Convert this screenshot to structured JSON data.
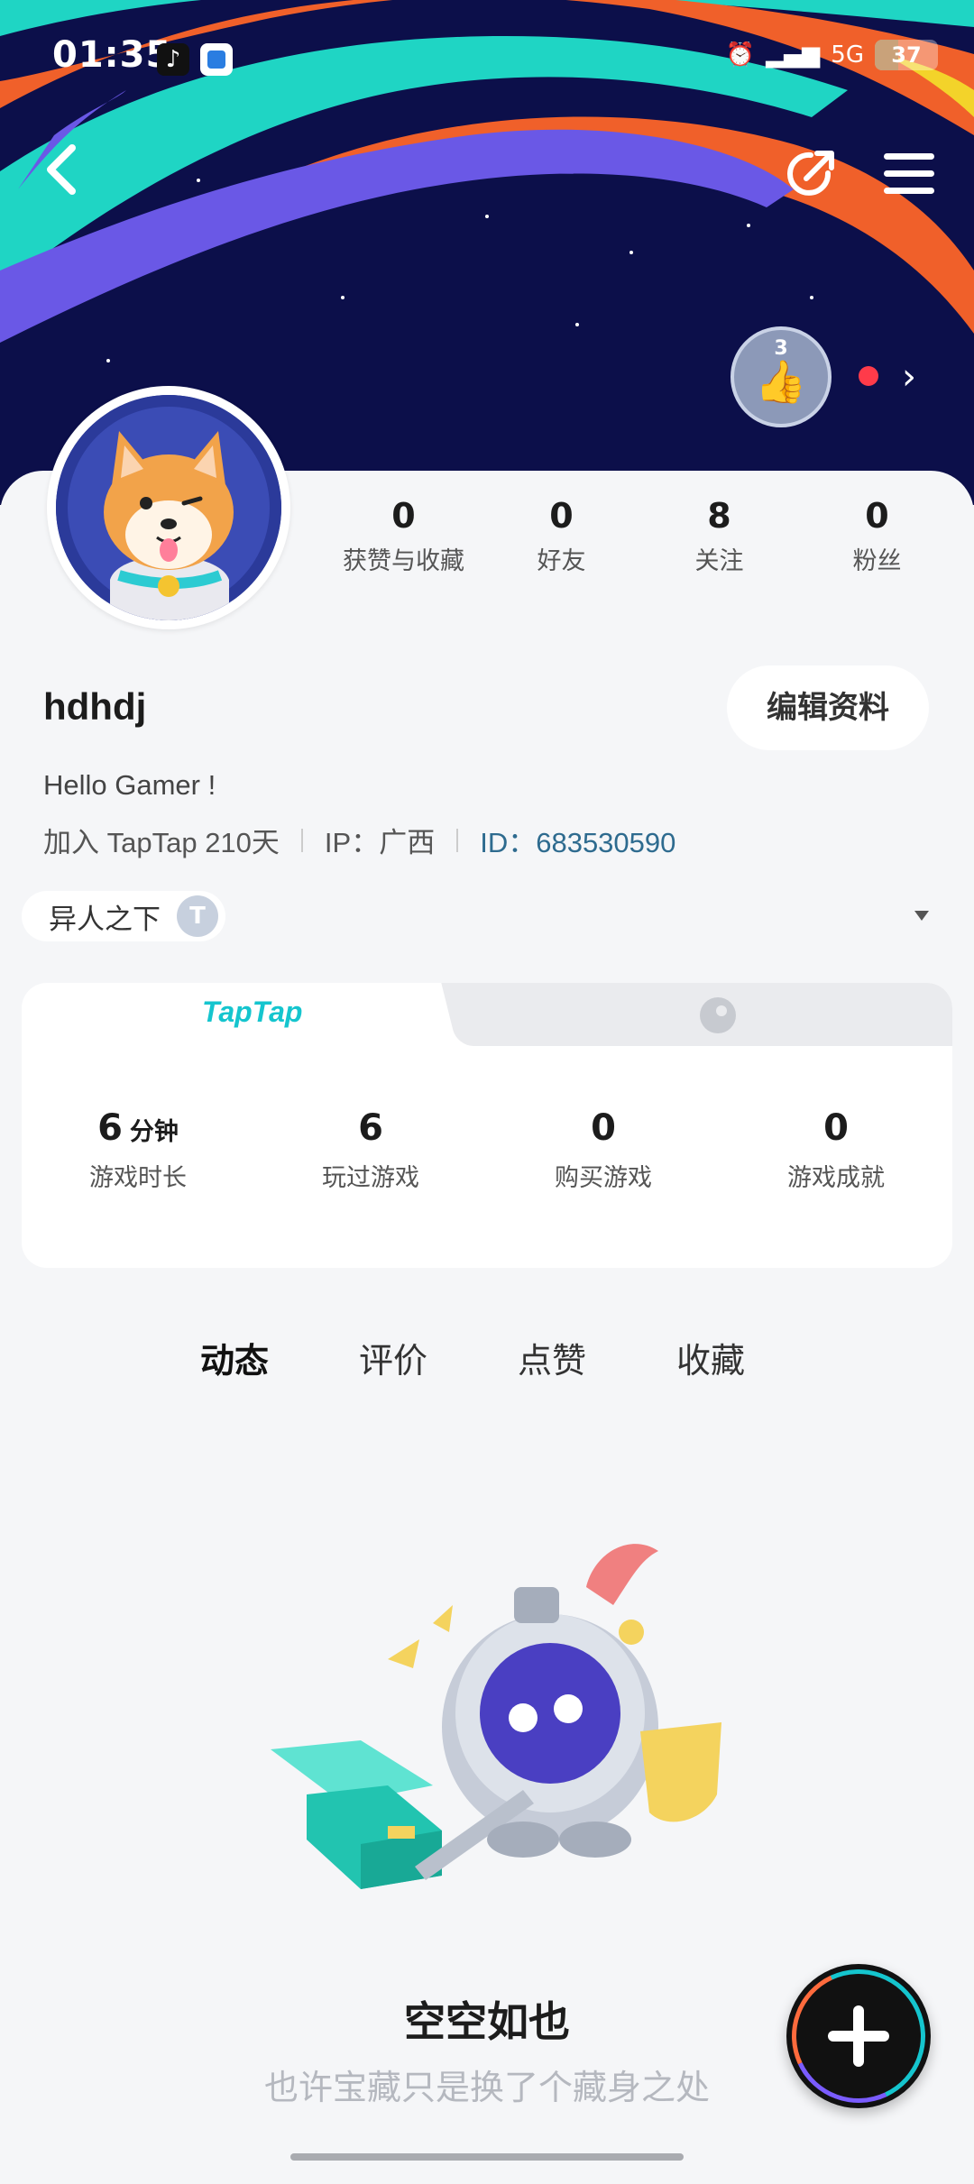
{
  "status_bar": {
    "time": "01:35",
    "network": "5G",
    "battery": "37"
  },
  "colors": {
    "accent": "#15c5ce",
    "id_link": "#2e6b8f",
    "banner_bg": "#0c0f4a"
  },
  "icons": {
    "back": "chevron-left-icon",
    "share": "share-icon",
    "menu": "menu-icon",
    "medal": "thumbs-up-medal-icon",
    "more": "chevron-right-icon",
    "dropdown": "caret-down-icon",
    "steam": "steam-icon",
    "fab": "plus-icon"
  },
  "medal": {
    "level": "3"
  },
  "profile": {
    "stats": [
      {
        "value": "0",
        "label": "获赞与收藏"
      },
      {
        "value": "0",
        "label": "好友"
      },
      {
        "value": "8",
        "label": "关注"
      },
      {
        "value": "0",
        "label": "粉丝"
      }
    ],
    "username": "hdhdj",
    "edit_label": "编辑资料",
    "bio": "Hello Gamer !",
    "joined": "加入 TapTap 210天",
    "ip": "IP：广西",
    "id": "ID：683530590",
    "game_chip": "异人之下",
    "game_chip_badge": "T"
  },
  "platform": {
    "tabs": [
      "TapTap",
      "Steam"
    ],
    "stats": [
      {
        "value": "6",
        "unit": "分钟",
        "label": "游戏时长"
      },
      {
        "value": "6",
        "unit": "",
        "label": "玩过游戏"
      },
      {
        "value": "0",
        "unit": "",
        "label": "购买游戏"
      },
      {
        "value": "0",
        "unit": "",
        "label": "游戏成就"
      }
    ]
  },
  "content_tabs": [
    "动态",
    "评价",
    "点赞",
    "收藏"
  ],
  "empty_state": {
    "title": "空空如也",
    "subtitle": "也许宝藏只是换了个藏身之处"
  }
}
